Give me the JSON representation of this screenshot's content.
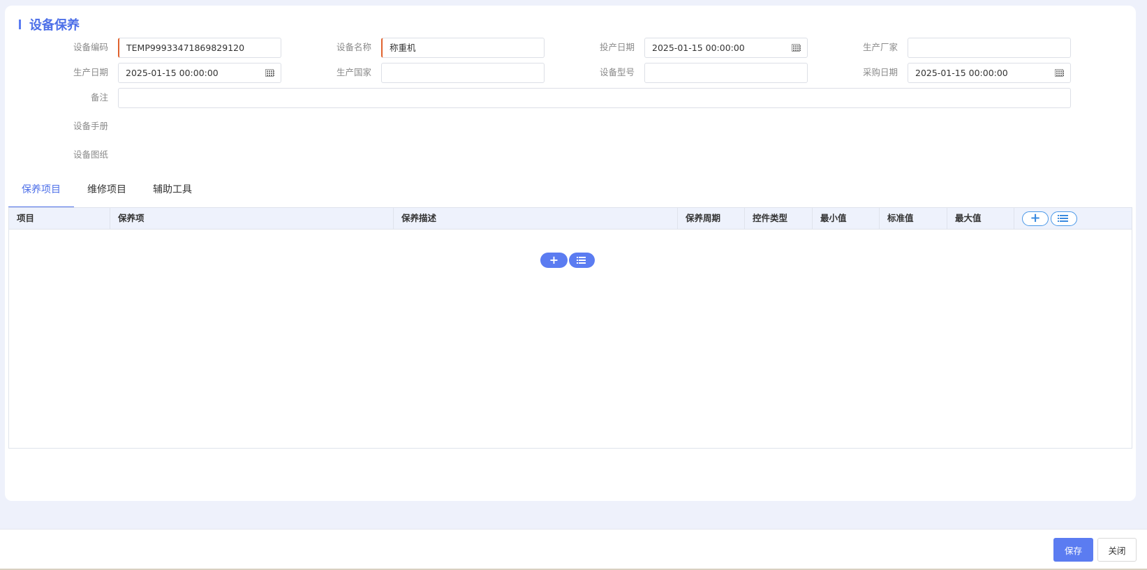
{
  "title": "设备保养",
  "form": {
    "device_code": {
      "label": "设备编码",
      "value": "TEMP99933471869829120"
    },
    "device_name": {
      "label": "设备名称",
      "value": "称重机"
    },
    "production_start_date": {
      "label": "投产日期",
      "value": "2025-01-15 00:00:00"
    },
    "manufacturer": {
      "label": "生产厂家",
      "value": ""
    },
    "production_date": {
      "label": "生产日期",
      "value": "2025-01-15 00:00:00"
    },
    "production_country": {
      "label": "生产国家",
      "value": ""
    },
    "device_model": {
      "label": "设备型号",
      "value": ""
    },
    "purchase_date": {
      "label": "采购日期",
      "value": "2025-01-15 00:00:00"
    },
    "remarks": {
      "label": "备注",
      "value": ""
    },
    "manual_label": "设备手册",
    "drawing_label": "设备图纸"
  },
  "tabs": [
    {
      "label": "保养项目",
      "active": true
    },
    {
      "label": "维修项目",
      "active": false
    },
    {
      "label": "辅助工具",
      "active": false
    }
  ],
  "grid": {
    "columns": [
      "项目",
      "保养项",
      "保养描述",
      "保养周期",
      "控件类型",
      "最小值",
      "标准值",
      "最大值"
    ],
    "rows": []
  },
  "icons": {
    "calendar": "calendar-icon",
    "add": "plus-icon",
    "list": "list-icon"
  },
  "footer": {
    "save_label": "保存",
    "close_label": "关闭"
  },
  "colors": {
    "accent": "#5b7cf1",
    "required_marker": "#e0622e"
  }
}
